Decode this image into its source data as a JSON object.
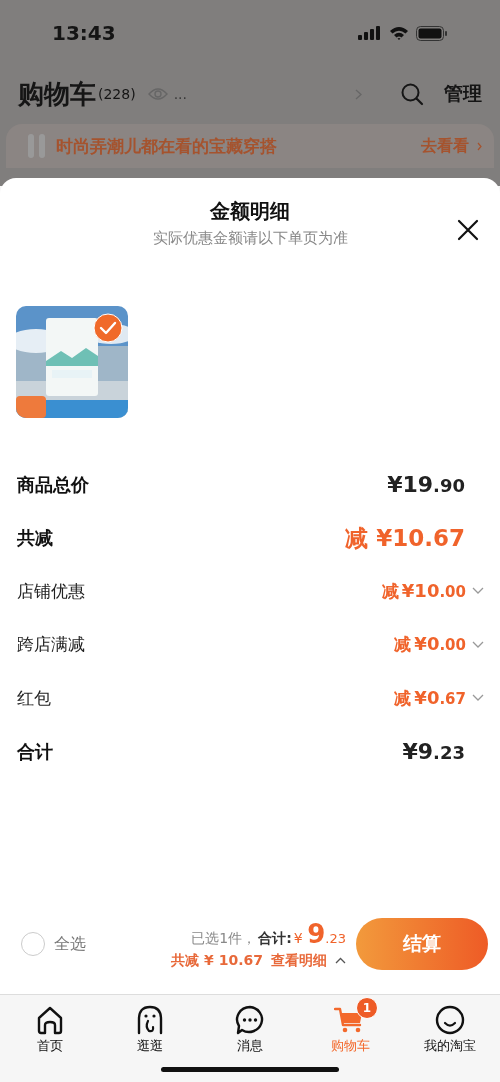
{
  "status_bar": {
    "time": "13:43"
  },
  "header": {
    "title": "购物车",
    "count": "(228)",
    "ellipsis": "...",
    "manage": "管理"
  },
  "banner": {
    "text": "时尚弄潮儿都在看的宝藏穿搭",
    "link": "去看看"
  },
  "sheet": {
    "title": "金额明细",
    "subtitle": "实际优惠金额请以下单页为准",
    "product": {
      "kind": "picture",
      "selected": true
    },
    "rows": [
      {
        "kind": "plain",
        "label": "商品总价",
        "value": "¥19.90"
      },
      {
        "kind": "discount",
        "label": "共减",
        "prefix": "减",
        "value": "¥10.67"
      },
      {
        "kind": "detail",
        "label": "店铺优惠",
        "prefix": "减",
        "value": "¥10.00",
        "expanded": false
      },
      {
        "kind": "detail",
        "label": "跨店满减",
        "prefix": "减",
        "value": "¥0.00",
        "expanded": false
      },
      {
        "kind": "detail",
        "label": "红包",
        "prefix": "减",
        "value": "¥0.67",
        "expanded": false
      },
      {
        "kind": "plain",
        "label": "合计",
        "value": "¥9.23"
      }
    ]
  },
  "checkout": {
    "select_all": {
      "label": "全选",
      "checked": false
    },
    "selected_text": "已选1件，",
    "total_label": "合计:",
    "currency": "¥",
    "total": "9.23",
    "saved": "共减 ¥ 10.67",
    "details_link": "查看明细",
    "details_expanded": true,
    "button": "结算"
  },
  "tabs": [
    {
      "kind": "home",
      "label": "首页",
      "selected": false
    },
    {
      "kind": "explore",
      "label": "逛逛",
      "selected": false
    },
    {
      "kind": "messages",
      "label": "消息",
      "selected": false
    },
    {
      "kind": "cart",
      "label": "购物车",
      "selected": true,
      "badge": "1"
    },
    {
      "kind": "profile",
      "label": "我的淘宝",
      "selected": false
    }
  ]
}
